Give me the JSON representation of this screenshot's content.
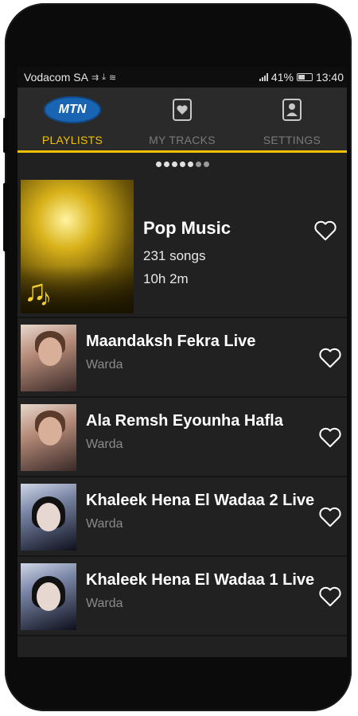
{
  "status_bar": {
    "carrier": "Vodacom SA",
    "battery": "41%",
    "time": "13:40"
  },
  "tabs": [
    {
      "label": "PLAYLISTS",
      "icon": "mtn-logo",
      "logo_text": "MTN",
      "active": true
    },
    {
      "label": "MY TRACKS",
      "icon": "heart-card-icon",
      "active": false
    },
    {
      "label": "SETTINGS",
      "icon": "user-card-icon",
      "active": false
    }
  ],
  "pager": {
    "count": 7,
    "active_dots": 5
  },
  "featured": {
    "title": "Pop Music",
    "songs": "231 songs",
    "duration": "10h 2m"
  },
  "tracks": [
    {
      "title": "Maandaksh Fekra Live",
      "artist": "Warda",
      "art": "warda1"
    },
    {
      "title": "Ala Remsh Eyounha Hafla",
      "artist": "Warda",
      "art": "warda1"
    },
    {
      "title": "Khaleek Hena El Wadaa 2 Live",
      "artist": "Warda",
      "art": "warda2"
    },
    {
      "title": "Khaleek Hena El Wadaa 1 Live",
      "artist": "Warda",
      "art": "warda2"
    }
  ],
  "colors": {
    "accent": "#f2c200",
    "background": "#212121",
    "tabbar": "#2a2a2a",
    "mtn_blue": "#1a64b4"
  }
}
